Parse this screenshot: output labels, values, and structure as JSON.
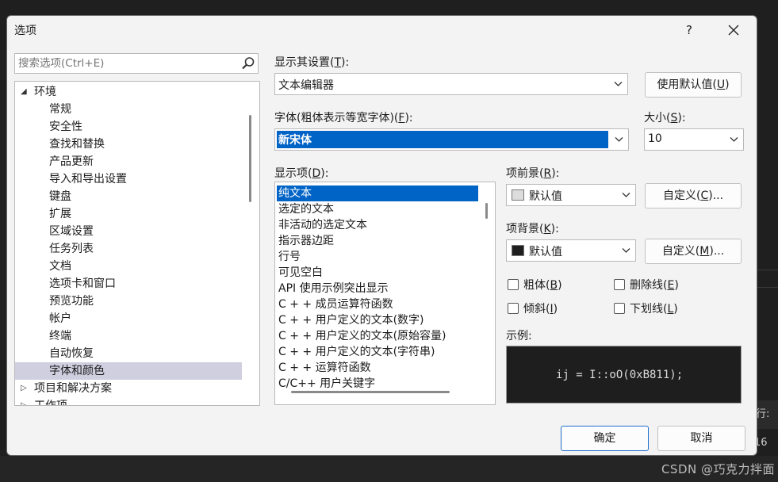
{
  "background": {
    "status_fragment": "行: 16",
    "watermark": "CSDN @巧克力拌面"
  },
  "dialog": {
    "title": "选项",
    "help_label": "?",
    "search_placeholder": "搜索选项(Ctrl+E)",
    "tree": {
      "root_label": "环境",
      "children": [
        "常规",
        "安全性",
        "查找和替换",
        "产品更新",
        "导入和导出设置",
        "键盘",
        "扩展",
        "区域设置",
        "任务列表",
        "文档",
        "选项卡和窗口",
        "预览功能",
        "帐户",
        "终端",
        "自动恢复",
        "字体和颜色"
      ],
      "selected": "字体和颜色",
      "next_root": "项目和解决方案",
      "last_root": "工作项"
    },
    "show_settings_for": {
      "label_pre": "显示其设置(",
      "key": "T",
      "label_post": "):",
      "value": "文本编辑器"
    },
    "use_defaults_button": {
      "pre": "使用默认值(",
      "key": "U",
      "post": ")"
    },
    "font": {
      "label_pre": "字体(粗体表示等宽字体)(",
      "key": "F",
      "label_post": "):",
      "value": "新宋体"
    },
    "size": {
      "label_pre": "大小(",
      "key": "S",
      "label_post": "):",
      "value": "10"
    },
    "display_items": {
      "label_pre": "显示项(",
      "key": "D",
      "label_post": "):",
      "items": [
        "纯文本",
        "选定的文本",
        "非活动的选定文本",
        "指示器边距",
        "行号",
        "可见空白",
        "API 使用示例突出显示",
        "C + + 成员运算符函数",
        "C + + 用户定义的文本(数字)",
        "C + + 用户定义的文本(原始容量)",
        "C + + 用户定义的文本(字符串)",
        "C + + 运算符函数",
        "C/C++ 用户关键字"
      ],
      "selected": "纯文本"
    },
    "item_foreground": {
      "label_pre": "项前景(",
      "key": "R",
      "label_post": "):",
      "value": "默认值",
      "swatch_color": "#dcdcdc"
    },
    "item_background": {
      "label_pre": "项背景(",
      "key": "K",
      "label_post": "):",
      "value": "默认值",
      "swatch_color": "#1e1e1e"
    },
    "custom_fg_button": {
      "pre": "自定义(",
      "key": "C",
      "post": ")..."
    },
    "custom_bg_button": {
      "pre": "自定义(",
      "key": "M",
      "post": ")..."
    },
    "checkboxes": {
      "bold": {
        "pre": "粗体(",
        "key": "B",
        "post": ")"
      },
      "strikethrough": {
        "pre": "删除线(",
        "key": "E",
        "post": ")"
      },
      "italic": {
        "pre": "倾斜(",
        "key": "I",
        "post": ")"
      },
      "underline": {
        "pre": "下划线(",
        "key": "L",
        "post": ")"
      }
    },
    "sample": {
      "label": "示例:",
      "text": "ij = I::oO(0xB811);"
    },
    "ok_button": "确定",
    "cancel_button": "取消"
  }
}
